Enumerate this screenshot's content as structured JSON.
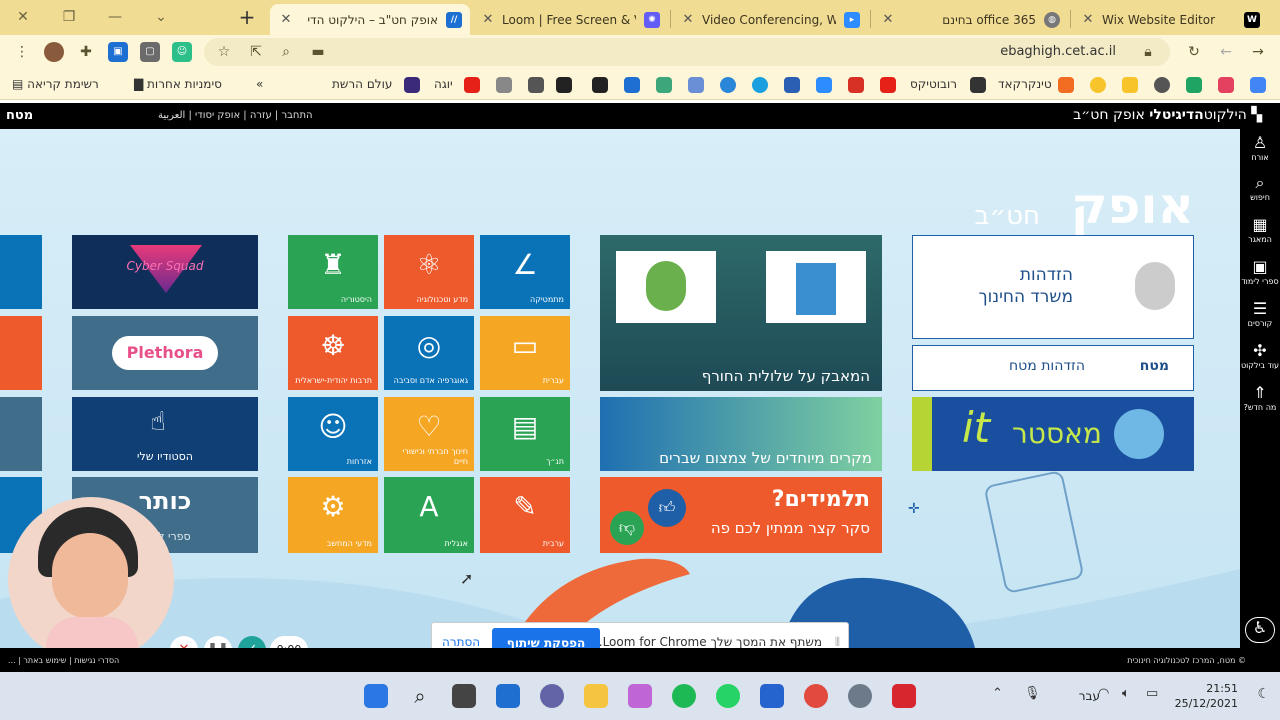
{
  "tabs": [
    {
      "title": "אופק חט\"ב – הילקוט הדי",
      "icon_color": "#1d6fd1",
      "active": true
    },
    {
      "title": "Loom | Free Screen & Vid",
      "icon_color": "#625df5",
      "active": false
    },
    {
      "title": "Video Conferencing, Web",
      "icon_color": "#2d8cff",
      "active": false
    },
    {
      "title": "office 365 בחינם",
      "icon_color": "#777777",
      "active": false
    },
    {
      "title": "Wix Website Editor",
      "icon_color": "#000000",
      "active": false
    }
  ],
  "new_tab": "+",
  "address": {
    "url": "ebaghigh.cet.ac.il"
  },
  "bookmarks": {
    "reading_list": "רשימת קריאה",
    "other": "סימניות אחרות",
    "chevron": "»",
    "items": [
      "עולם הרשת",
      "יוגה",
      "רובוטיקס",
      "טינקרקאד"
    ]
  },
  "site": {
    "brand_bold": "הדיגיטלי",
    "brand_pre": "הילקוט",
    "brand_post": "אופק חט״ב",
    "links": "התחבר | עזרה | אופק יסודי | العربية",
    "logo": "מטח"
  },
  "sidemenu": [
    {
      "label": "אורח",
      "icon": "person-icon"
    },
    {
      "label": "חיפוש",
      "icon": "search-icon"
    },
    {
      "label": "המאגר",
      "icon": "grid-icon"
    },
    {
      "label": "ספרי לימוד",
      "icon": "book-icon"
    },
    {
      "label": "קורסים",
      "icon": "course-icon"
    },
    {
      "label": "עוד בילקוט",
      "icon": "more-icon"
    },
    {
      "label": "מה חדש?",
      "icon": "rocket-icon"
    }
  ],
  "main": {
    "title": "אופק",
    "subtitle": "חט״ב",
    "login_edu": {
      "line1": "הזדהות",
      "line2": "משרד החינוך"
    },
    "login_matach": {
      "label": "הזדהות מטח",
      "logo": "מטח"
    },
    "it_master": {
      "it": "it",
      "text": "מאסטר"
    },
    "card_sustain": "המאבק על שלולית החורף",
    "card_fractions": "מקרים מיוחדים של צמצום שברים",
    "card_students": {
      "title": "תלמידים?",
      "subtitle": "סקר קצר ממתין לכם פה"
    },
    "subjects": [
      {
        "label": "מתמטיקה",
        "color": "#0a73b8",
        "icon": "∠"
      },
      {
        "label": "מדע וטכנולוגיה",
        "color": "#ee5a2b",
        "icon": "⚛"
      },
      {
        "label": "היסטוריה",
        "color": "#2aa454",
        "icon": "♜"
      },
      {
        "label": "עברית",
        "color": "#f5a623",
        "icon": "▭"
      },
      {
        "label": "גאוגרפיה אדם וסביבה",
        "color": "#0a73b8",
        "icon": "◎"
      },
      {
        "label": "תרבות יהודית-ישראלית",
        "color": "#ee5a2b",
        "icon": "☸"
      },
      {
        "label": "תנ״ך",
        "color": "#2aa454",
        "icon": "▤"
      },
      {
        "label": "חינוך חברתי וכישורי חיים",
        "color": "#f5a623",
        "icon": "♡"
      },
      {
        "label": "אזרחות",
        "color": "#0a73b8",
        "icon": "☺"
      },
      {
        "label": "ערבית",
        "color": "#ee5a2b",
        "icon": "✎"
      },
      {
        "label": "אנגלית",
        "color": "#2aa454",
        "icon": "A"
      },
      {
        "label": "מדעי המחשב",
        "color": "#f5a623",
        "icon": "⚙"
      }
    ],
    "promo": {
      "cyber": "Cyber Squad",
      "plethora": "Plethora",
      "studio": "הסטודיו שלי",
      "kotar": "כותר",
      "kotar_sub": "ספרי לימוד"
    }
  },
  "loom": {
    "message": "משתף את המסך שלך Loom for Chrome.",
    "stop": "הפסקת שיתוף",
    "hide": "הסתרה",
    "timer": "0:00"
  },
  "footer": {
    "right": "© מטח, המרכז לטכנולוגיה חינוכית",
    "left": "הסדרי נגישות | שימוש באתר | ..."
  },
  "taskbar": {
    "lang": "עבר",
    "time": "21:51",
    "date": "25/12/2021"
  }
}
